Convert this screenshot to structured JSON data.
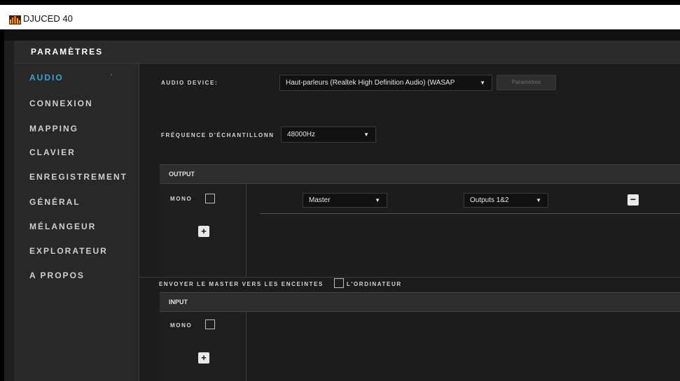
{
  "window": {
    "title": "DJUCED 40"
  },
  "header": {
    "title": "PARAMÈTRES"
  },
  "sidebar": {
    "items": [
      {
        "label": "AUDIO",
        "active": true
      },
      {
        "label": "CONNEXION"
      },
      {
        "label": "MAPPING"
      },
      {
        "label": "CLAVIER"
      },
      {
        "label": "ENREGISTREMENT"
      },
      {
        "label": "GÉNÉRAL"
      },
      {
        "label": "MÉLANGEUR"
      },
      {
        "label": "EXPLORATEUR"
      },
      {
        "label": "A PROPOS"
      }
    ],
    "active_arrow": "›"
  },
  "audio": {
    "device_label": "AUDIO DEVICE:",
    "device_value": "Haut-parleurs (Realtek High Definition Audio) (WASAP",
    "params_button": "Paramètres",
    "rate_label": "FRÉQUENCE D'ÉCHANTILLONN",
    "rate_value": "48000Hz"
  },
  "output": {
    "title": "OUTPUT",
    "mono_label": "MONO",
    "mono_checked": false,
    "add_label": "+",
    "source_value": "Master",
    "dest_value": "Outputs 1&2",
    "remove_label": "−"
  },
  "send_master": {
    "label_left": "ENVOYER LE MASTER VERS LES ENCEINTES",
    "label_right": "L'ORDINATEUR",
    "checked": false
  },
  "input": {
    "title": "INPUT",
    "mono_label": "MONO",
    "mono_checked": false,
    "add_label": "+"
  },
  "dropdown_arrow": "▼",
  "colors": {
    "accent": "#35a6d6",
    "background": "#1c1c1c",
    "sidebar": "#282828"
  }
}
